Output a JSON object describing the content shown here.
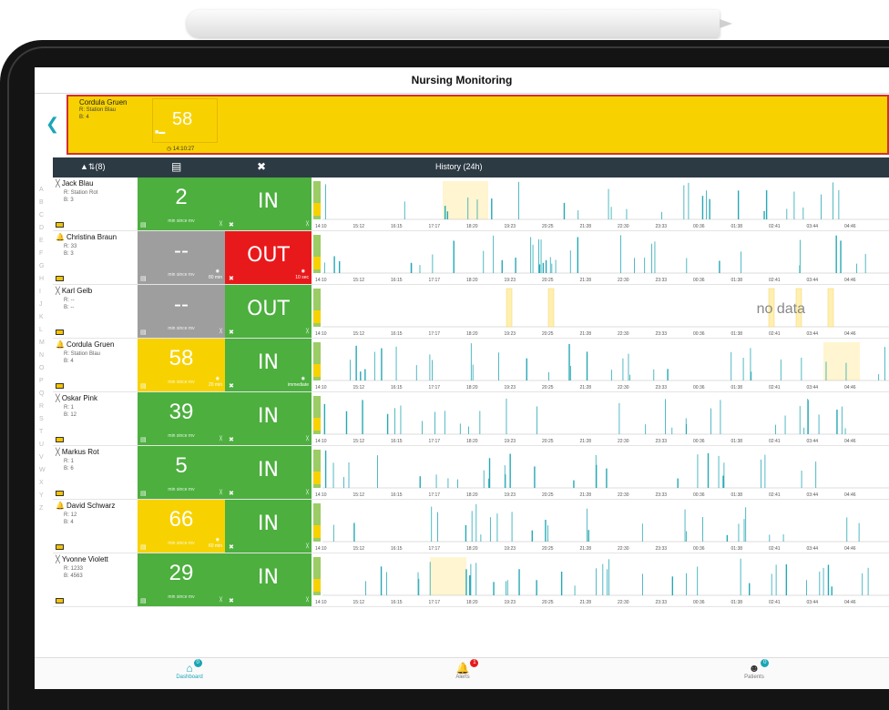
{
  "app": {
    "title": "Nursing Monitoring"
  },
  "banner": {
    "name": "Cordula Gruen",
    "room": "R: Station Blau",
    "bed": "B: 4",
    "value": "58",
    "time": "14:10:27"
  },
  "header": {
    "count": "(8)",
    "history": "History (24h)"
  },
  "letters": [
    "A",
    "B",
    "C",
    "D",
    "E",
    "F",
    "G",
    "H",
    "I",
    "J",
    "K",
    "L",
    "M",
    "N",
    "O",
    "P",
    "Q",
    "R",
    "S",
    "T",
    "U",
    "V",
    "W",
    "X",
    "Y",
    "Z"
  ],
  "min_since": "min since mv",
  "time_ticks": [
    "14:10",
    "15:12",
    "16:15",
    "17:17",
    "18:20",
    "19:23",
    "20:25",
    "21:28",
    "22:30",
    "23:33",
    "00:36",
    "01:38",
    "02:41",
    "03:44",
    "04:46"
  ],
  "patients": [
    {
      "name": "Jack Blau",
      "icon": "no-alarm-icon",
      "room": "R: Station Rot",
      "bed": "B: 3",
      "value": "2",
      "c1": "green",
      "c1_dur": "",
      "status": "IN",
      "c2": "green",
      "c2_dur": "",
      "no_data": ""
    },
    {
      "name": "Christina Braun",
      "icon": "bell-icon",
      "room": "R: 33",
      "bed": "B: 3",
      "value": "--",
      "c1": "gray",
      "c1_dur": "80 min",
      "status": "OUT",
      "c2": "red",
      "c2_dur": "10 sec",
      "no_data": ""
    },
    {
      "name": "Karl Gelb",
      "icon": "no-alarm-icon",
      "room": "R: --",
      "bed": "B: --",
      "value": "--",
      "c1": "gray",
      "c1_dur": "",
      "status": "OUT",
      "c2": "green",
      "c2_dur": "",
      "no_data": "no data"
    },
    {
      "name": "Cordula Gruen",
      "icon": "bell-icon",
      "room": "R: Station Blau",
      "bed": "B: 4",
      "value": "58",
      "c1": "yellow",
      "c1_dur": "20 min",
      "status": "IN",
      "c2": "green",
      "c2_dur": "immediate",
      "no_data": ""
    },
    {
      "name": "Oskar Pink",
      "icon": "no-alarm-icon",
      "room": "R: 1",
      "bed": "B: 12",
      "value": "39",
      "c1": "green",
      "c1_dur": "",
      "status": "IN",
      "c2": "green",
      "c2_dur": "",
      "no_data": ""
    },
    {
      "name": "Markus Rot",
      "icon": "no-alarm-icon",
      "room": "R: 1",
      "bed": "B: 6",
      "value": "5",
      "c1": "green",
      "c1_dur": "",
      "status": "IN",
      "c2": "green",
      "c2_dur": "",
      "no_data": ""
    },
    {
      "name": "David Schwarz",
      "icon": "bell-icon",
      "room": "R: 12",
      "bed": "B: 4",
      "value": "66",
      "c1": "yellow",
      "c1_dur": "60 min",
      "status": "IN",
      "c2": "green",
      "c2_dur": "",
      "no_data": ""
    },
    {
      "name": "Yvonne Violett",
      "icon": "no-alarm-icon",
      "room": "R: 1233",
      "bed": "B: 4563",
      "value": "29",
      "c1": "green",
      "c1_dur": "",
      "status": "IN",
      "c2": "green",
      "c2_dur": "",
      "no_data": ""
    }
  ],
  "tabs": [
    {
      "label": "Dashboard",
      "badge": "0",
      "icon": "home-icon"
    },
    {
      "label": "Alerts",
      "badge": "1",
      "icon": "bell-icon"
    },
    {
      "label": "Patients",
      "badge": "0",
      "icon": "users-icon"
    }
  ],
  "colors": {
    "accent": "#19a6b6",
    "green": "#4caf3e",
    "yellow": "#f7d200",
    "red": "#e8191b",
    "gray": "#9e9e9e",
    "header": "#2c3a44"
  }
}
